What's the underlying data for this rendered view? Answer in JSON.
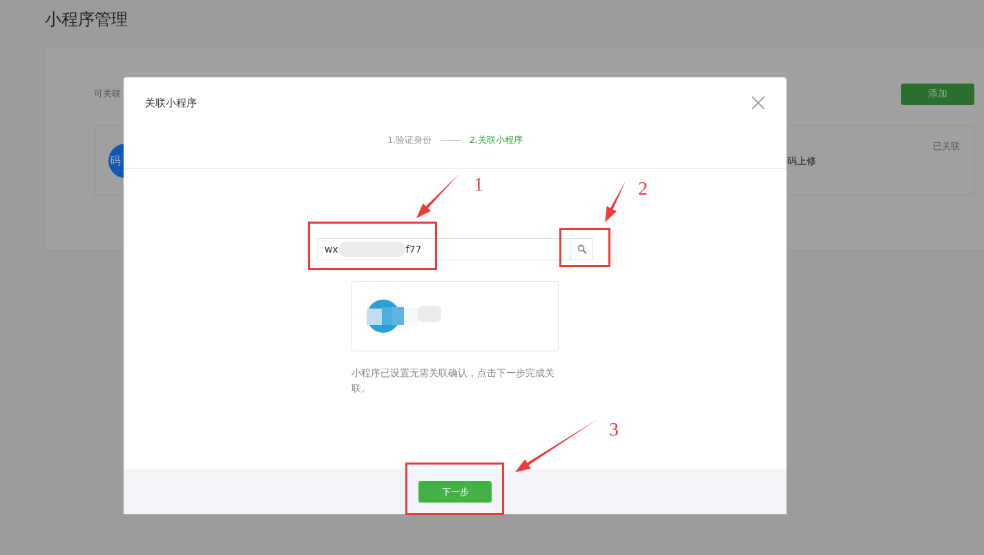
{
  "page_title": "小程序管理",
  "panel": {
    "label": "可关联",
    "add_button": "添加",
    "card": {
      "avatar_text": "码",
      "name_fragment": "码上修",
      "status": "已关联"
    }
  },
  "dialog": {
    "title": "关联小程序",
    "steps": [
      {
        "label": "1.验证身份",
        "selected": false
      },
      {
        "label": "2.关联小程序",
        "selected": true
      }
    ],
    "search": {
      "value_start": "wx",
      "value_end": "f77"
    },
    "note": "小程序已设置无需关联确认，点击下一步完成关联。",
    "next_button": "下一步"
  },
  "annotations": [
    {
      "label": "1"
    },
    {
      "label": "2"
    },
    {
      "label": "3"
    }
  ]
}
